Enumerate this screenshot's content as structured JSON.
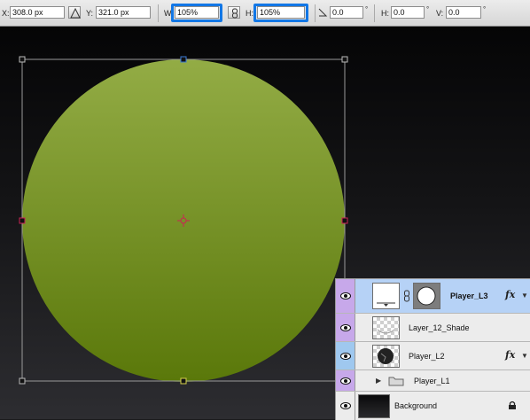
{
  "options_bar": {
    "x_label": "X:",
    "x_value": "308.0 px",
    "y_label": "Y:",
    "y_value": "321.0 px",
    "w_label": "W:",
    "w_value": "105%",
    "h_label": "H:",
    "h_value": "105%",
    "rotate_value": "0.0",
    "rotate_unit": "°",
    "skew_h_label": "H:",
    "skew_h_value": "0.0",
    "skew_h_unit": "°",
    "skew_v_label": "V:",
    "skew_v_value": "0.0",
    "skew_v_unit": "°",
    "highlight_color": "#1277e6"
  },
  "canvas": {
    "circle_gradient_top": "#93ac45",
    "circle_gradient_bottom": "#5a780a",
    "transform_handle_color": "#cc2255"
  },
  "layers": {
    "items": [
      {
        "name": "Player_L3",
        "selected": true,
        "fx": "fx",
        "thumb": "mask",
        "eye_color": "#c7a8ea"
      },
      {
        "name": "Layer_12_Shade",
        "selected": false,
        "fx": "",
        "thumb": "shade",
        "eye_color": "#c7a8ea"
      },
      {
        "name": "Player_L2",
        "selected": false,
        "fx": "fx",
        "thumb": "ball",
        "eye_color": "#9fc8ef"
      },
      {
        "name": "Player_L1",
        "selected": false,
        "fx": "",
        "thumb": "group",
        "eye_color": "#c7a8ea"
      },
      {
        "name": "Background",
        "selected": false,
        "fx": "",
        "thumb": "bg",
        "eye_color": "#ececec"
      }
    ]
  }
}
